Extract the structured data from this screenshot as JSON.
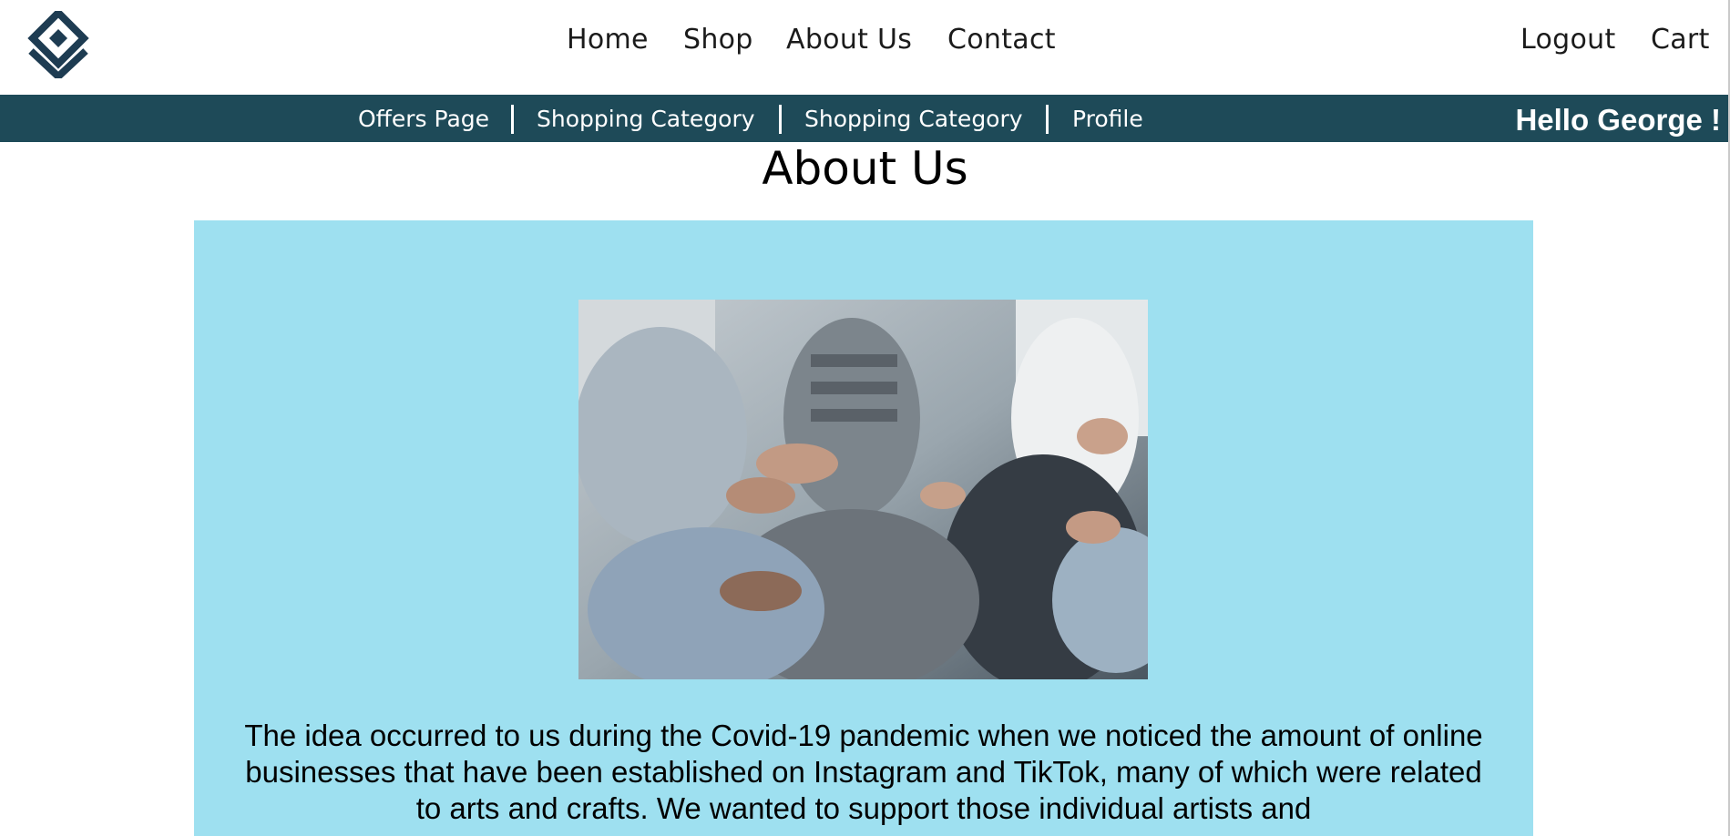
{
  "nav": {
    "home": "Home",
    "shop": "Shop",
    "about": "About Us",
    "contact": "Contact",
    "logout": "Logout",
    "cart": "Cart"
  },
  "subnav": {
    "offers": "Offers Page",
    "category_1": "Shopping Category",
    "category_2": "Shopping Category",
    "profile": "Profile",
    "greeting": "Hello George !"
  },
  "page": {
    "title": "About Us"
  },
  "about": {
    "text": "The idea occurred to us during the Covid-19 pandemic when we noticed the amount of online businesses that have been established on Instagram and TikTok, many of which were related to arts and crafts. We wanted to support those individual artists and"
  },
  "colors": {
    "subbar": "#1e4a58",
    "panel": "#9ee0f0",
    "logo": "#1e3c52"
  },
  "icons": {
    "logo": "diamond-logo-icon"
  }
}
